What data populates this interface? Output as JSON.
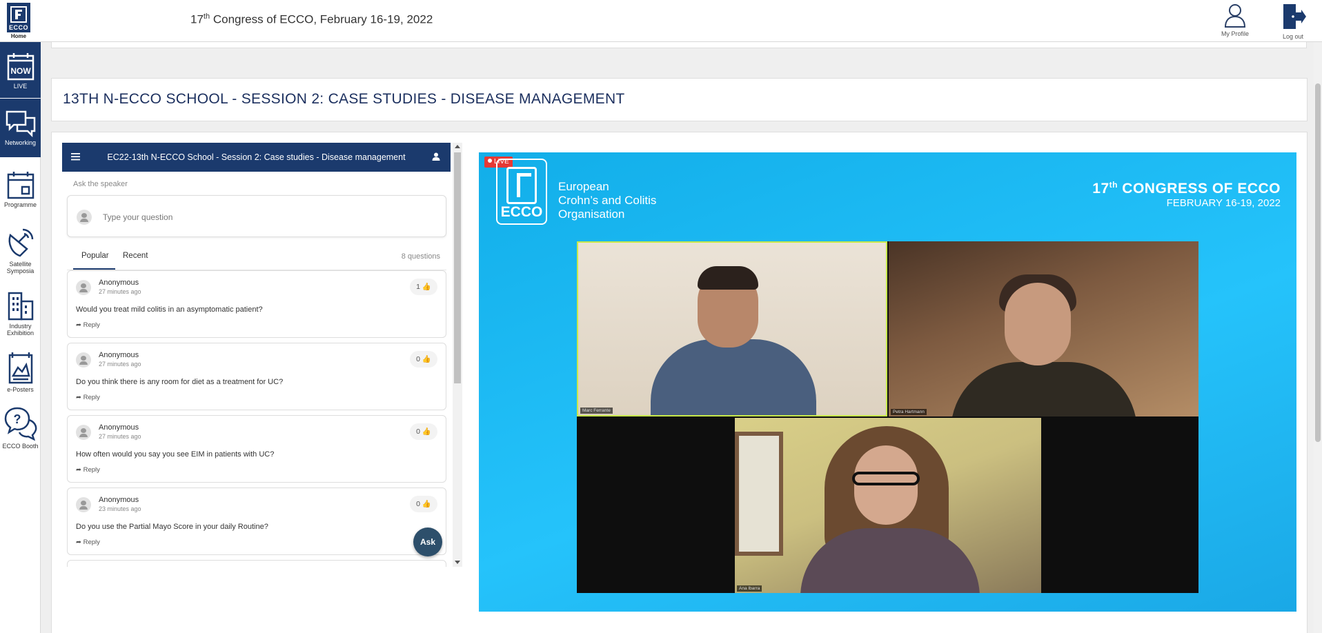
{
  "header": {
    "home_logo_text": "ECCO",
    "home_label": "Home",
    "title_prefix": "17",
    "title_sup": "th",
    "title_rest": " Congress of ECCO, February 16-19, 2022",
    "my_profile_label": "My Profile",
    "logout_label": "Log out"
  },
  "sidebar": {
    "items": [
      {
        "label": "LIVE",
        "icon": "now-calendar-icon",
        "active": true
      },
      {
        "label": "Networking",
        "icon": "chat-bubbles-icon",
        "active": true
      },
      {
        "label": "Programme",
        "icon": "calendar-icon"
      },
      {
        "label": "Satellite Symposia",
        "icon": "satellite-dish-icon"
      },
      {
        "label": "Industry Exhibition",
        "icon": "buildings-icon"
      },
      {
        "label": "e-Posters",
        "icon": "poster-icon"
      },
      {
        "label": "ECCO Booth",
        "icon": "chat-question-icon"
      }
    ],
    "now_text": "NOW"
  },
  "session": {
    "title": "13TH N-ECCO SCHOOL - SESSION 2: CASE STUDIES - DISEASE MANAGEMENT"
  },
  "qa": {
    "topbar_title": "EC22-13th N-ECCO School - Session 2: Case studies - Disease management",
    "ask_label": "Ask the speaker",
    "input_placeholder": "Type your question",
    "tabs": [
      "Popular",
      "Recent"
    ],
    "count_label": "8 questions",
    "reply_label": "Reply",
    "ask_button": "Ask",
    "questions": [
      {
        "author": "Anonymous",
        "time": "27 minutes ago",
        "votes": "1",
        "text": "Would you treat mild colitis in an asymptomatic patient?"
      },
      {
        "author": "Anonymous",
        "time": "27 minutes ago",
        "votes": "0",
        "text": "Do you think there is any room for diet as a treatment for UC?"
      },
      {
        "author": "Anonymous",
        "time": "27 minutes ago",
        "votes": "0",
        "text": "How often would you say you see EIM in patients with UC?"
      },
      {
        "author": "Anonymous",
        "time": "23 minutes ago",
        "votes": "0",
        "text": "Do you use the Partial Mayo Score in your daily Routine?"
      }
    ]
  },
  "video": {
    "live_badge": "LIVE",
    "logo_text": "ECCO",
    "org_name_line1": "European",
    "org_name_line2": "Crohn’s and Colitis",
    "org_name_line3": "Organisation",
    "congress_prefix": "17",
    "congress_sup": "th",
    "congress_rest": " CONGRESS OF ECCO",
    "congress_dates": "FEBRUARY 16-19, 2022",
    "speakers": [
      "Marc Ferrante",
      "Petra Hartmann",
      "Ana Ibarra"
    ]
  },
  "colors": {
    "brand_navy": "#1b3a6d",
    "video_blue": "#1ab8f3",
    "live_red": "#e53935",
    "ask_button": "#2d4f6b"
  }
}
